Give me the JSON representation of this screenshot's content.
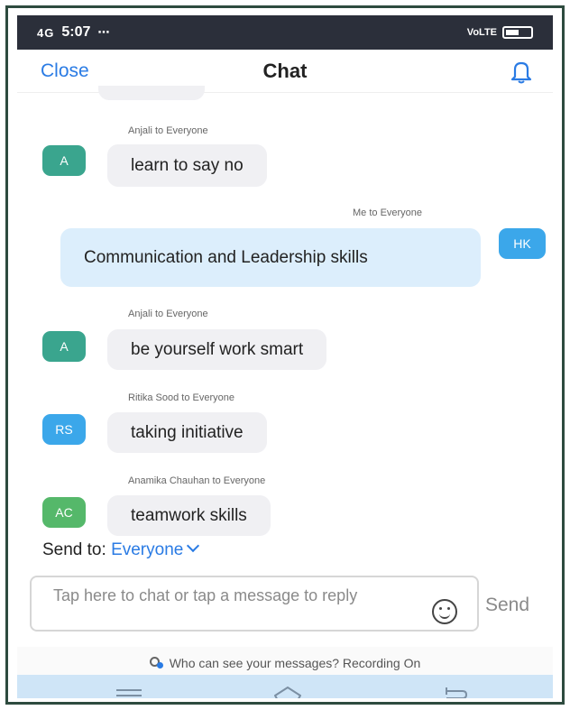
{
  "status_bar": {
    "time": "5:07",
    "network_left": "4G",
    "extras": "⋯",
    "network_right": "VoLTE"
  },
  "header": {
    "close_label": "Close",
    "title": "Chat"
  },
  "messages": [
    {
      "sender": "Anjali to Everyone",
      "initials": "A",
      "avatar_color": "#3aa58e",
      "text": "learn to say no",
      "me": false
    },
    {
      "sender": "Me to Everyone",
      "initials": "HK",
      "avatar_color": "#3ba7ea",
      "text": "Communication and Leadership skills",
      "me": true
    },
    {
      "sender": "Anjali to Everyone",
      "initials": "A",
      "avatar_color": "#3aa58e",
      "text": "be yourself work smart",
      "me": false
    },
    {
      "sender": "Ritika Sood to Everyone",
      "initials": "RS",
      "avatar_color": "#3ba7ea",
      "text": "taking initiative",
      "me": false
    },
    {
      "sender": "Anamika Chauhan to Everyone",
      "initials": "AC",
      "avatar_color": "#55b86a",
      "text": "teamwork skills",
      "me": false
    }
  ],
  "send_to": {
    "label": "Send to:",
    "recipient": "Everyone"
  },
  "input": {
    "placeholder": "Tap here to chat or tap a message to reply",
    "send_label": "Send"
  },
  "note": {
    "text": "Who can see your messages? Recording On"
  },
  "colors": {
    "accent": "#2a7be4",
    "bubble": "#f0f0f3",
    "my_bubble": "#dceefc",
    "status_bar": "#2b2f3a",
    "nav_bar": "#cfe5f7"
  }
}
